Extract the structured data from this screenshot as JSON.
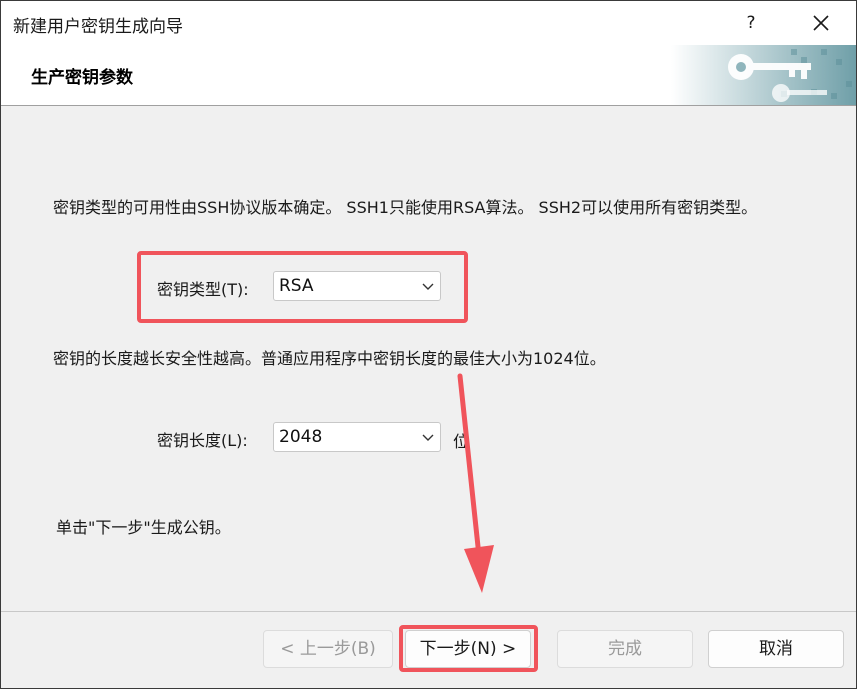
{
  "window": {
    "title": "新建用户密钥生成向导",
    "help_label": "?"
  },
  "header": {
    "title": "生产密钥参数"
  },
  "content": {
    "key_type_desc": "密钥类型的可用性由SSH协议版本确定。 SSH1只能使用RSA算法。 SSH2可以使用所有密钥类型。",
    "key_type_label": "密钥类型(T):",
    "key_type_value": "RSA",
    "key_length_desc": "密钥的长度越长安全性越高。普通应用程序中密钥长度的最佳大小为1024位。",
    "key_length_label": "密钥长度(L):",
    "key_length_value": "2048",
    "key_length_unit": "位",
    "instruction": "单击\"下一步\"生成公钥。"
  },
  "buttons": {
    "back": "< 上一步(B)",
    "next": "下一步(N) >",
    "finish": "完成",
    "cancel": "取消"
  },
  "colors": {
    "highlight": "#f0545b"
  }
}
